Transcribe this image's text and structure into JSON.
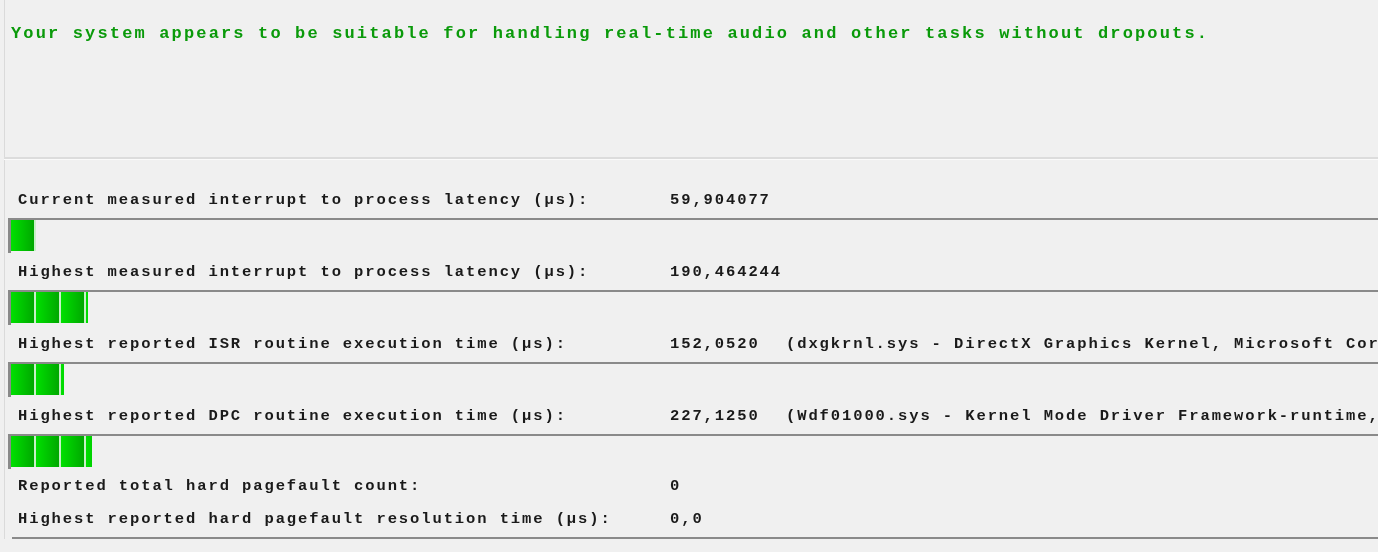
{
  "status_message": "Your system appears to be suitable for handling real-time audio and other tasks without dropouts.",
  "measurements": [
    {
      "label": "Current measured interrupt to process latency (µs):",
      "value": "59,904077",
      "meter": {
        "level": 0.018
      }
    },
    {
      "label": "Highest measured interrupt to process latency (µs):",
      "value": "190,464244",
      "meter": {
        "level": 0.056
      }
    },
    {
      "label": "Highest reported ISR routine execution time (µs):",
      "value": "152,0520",
      "detail": "(dxgkrnl.sys - DirectX Graphics Kernel, Microsoft Cor",
      "meter": {
        "level": 0.039
      }
    },
    {
      "label": "Highest reported DPC routine execution time (µs):",
      "value": "227,1250",
      "detail": "(Wdf01000.sys - Kernel Mode Driver Framework-runtime,",
      "meter": {
        "level": 0.059
      }
    },
    {
      "label": "Reported total hard pagefault count:",
      "value": "0"
    },
    {
      "label": "Highest reported hard pagefault resolution time (µs):",
      "value": "0,0"
    }
  ]
}
